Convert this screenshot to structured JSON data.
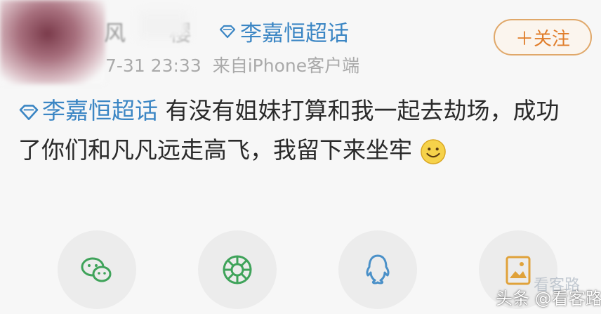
{
  "post": {
    "author": {
      "name_visible": "风",
      "name_tail": "樱"
    },
    "topic_tag": "李嘉恒超话",
    "timestamp": "7-31 23:33",
    "source": "来自iPhone客户端",
    "follow_label": "＋关注",
    "body_topic": "李嘉恒超话",
    "body_text": " 有没有姐妹打算和我一起去劫场，成功了你们和凡凡远走高飞，我留下来坐牢",
    "emoji": "smile"
  },
  "share_icons": [
    "wechat-icon",
    "moments-icon",
    "qq-icon",
    "qzone-icon"
  ],
  "watermark": {
    "faint_text": "看客路",
    "text": "头条 @看客路"
  },
  "colors": {
    "topic_blue": "#3b86c4",
    "follow_orange": "#e07d2a",
    "icon_green": "#3fa35a",
    "icon_blue": "#4a90c8",
    "icon_amber": "#e0a23a"
  }
}
